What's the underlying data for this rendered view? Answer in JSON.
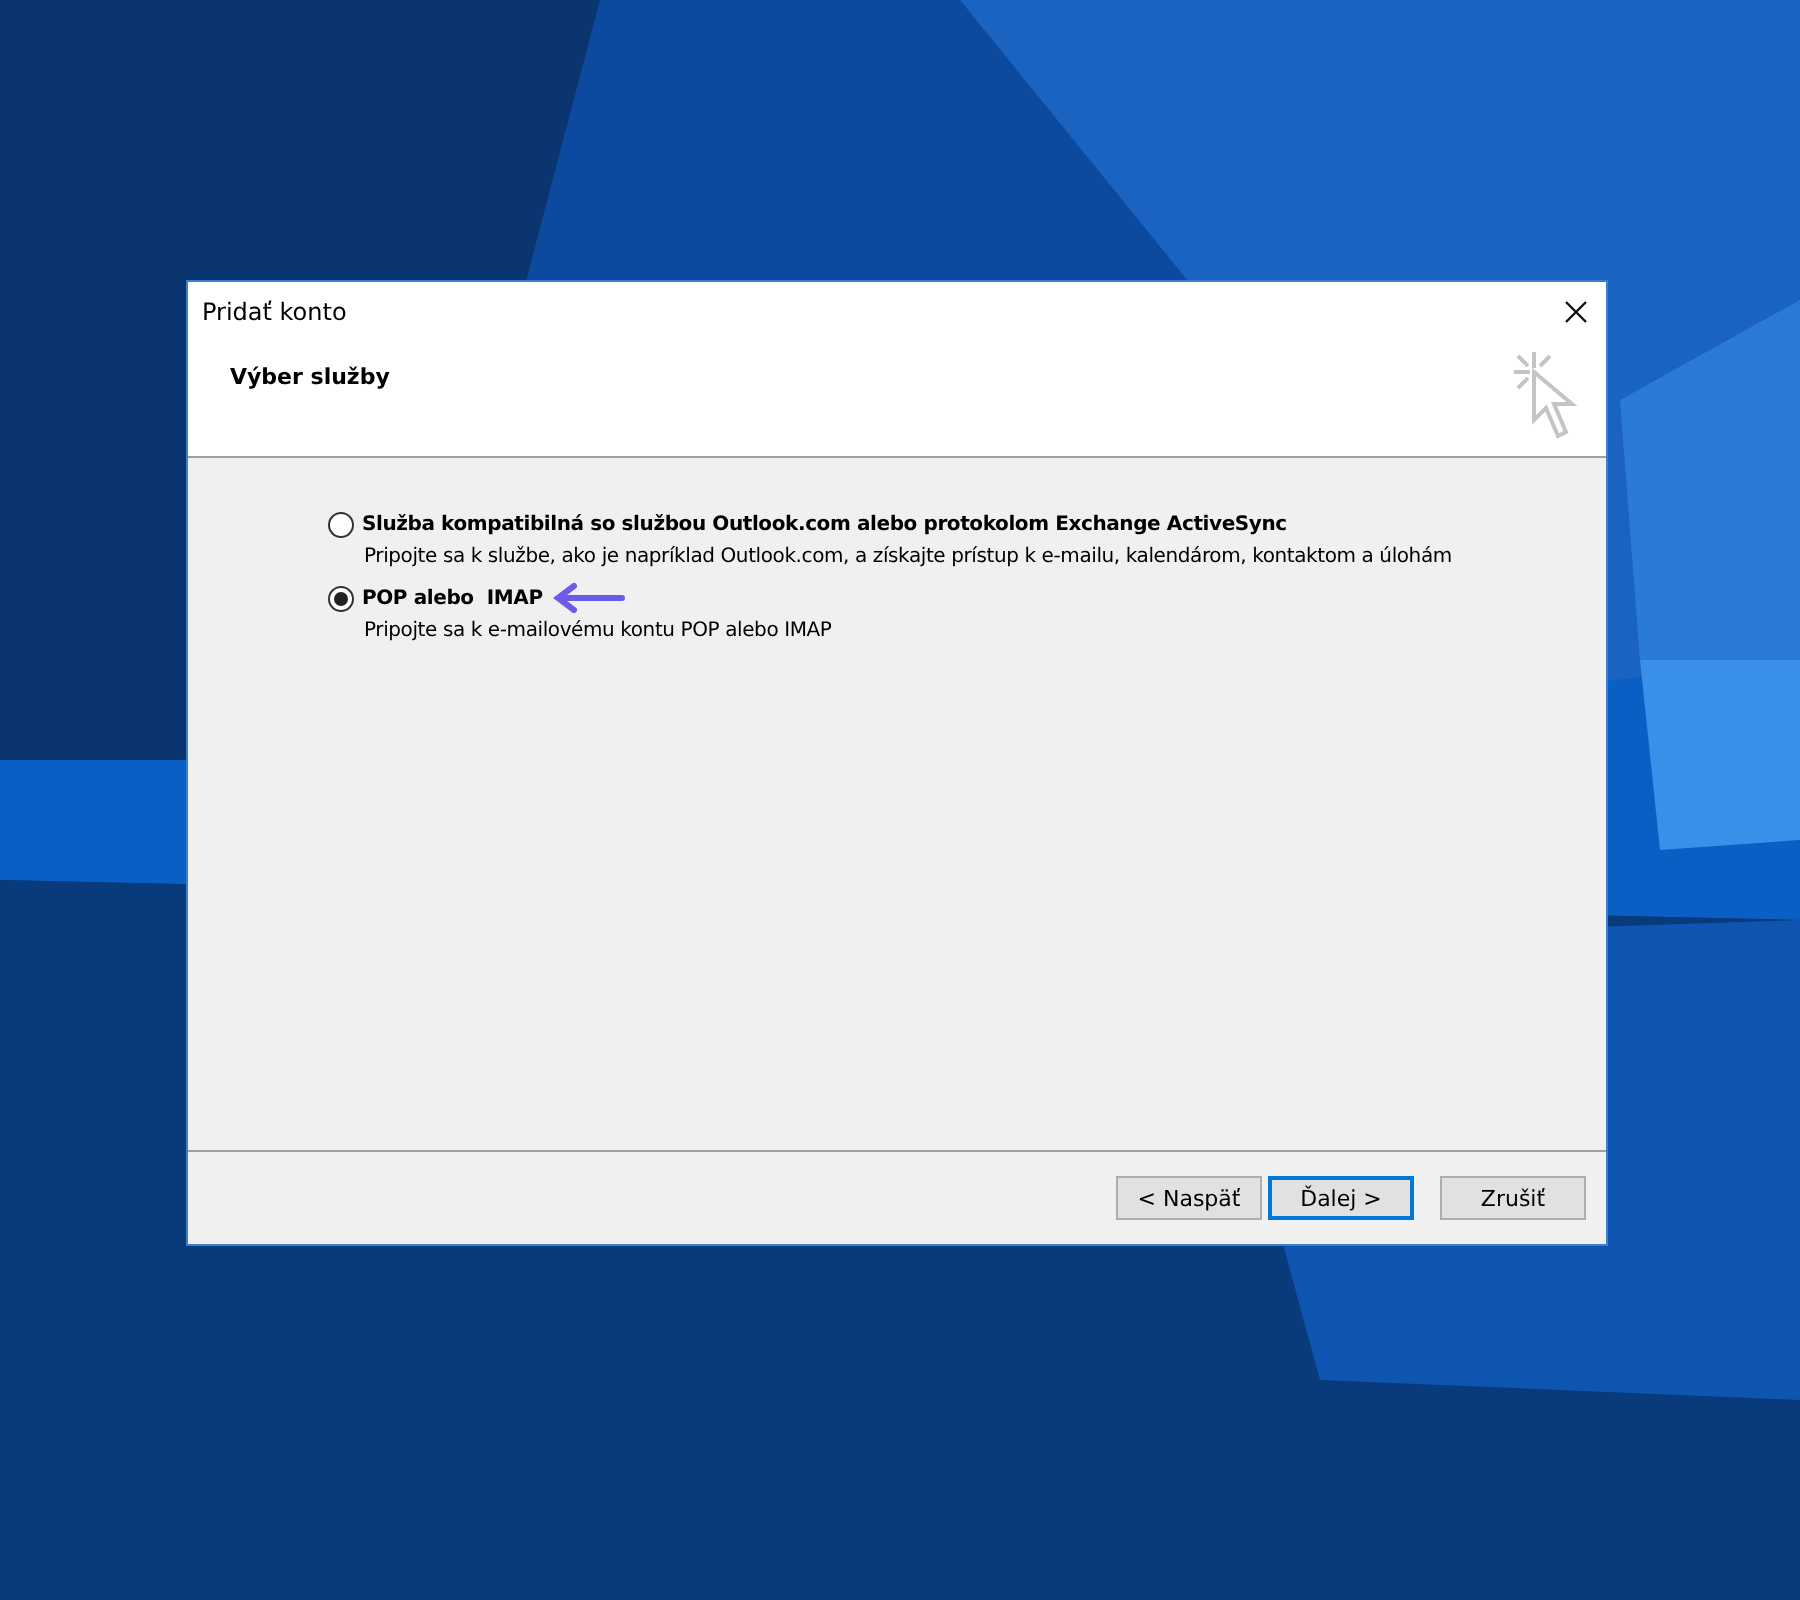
{
  "window": {
    "title": "Pridať konto",
    "heading": "Výber služby"
  },
  "options": [
    {
      "label": "Služba kompatibilná so službou Outlook.com alebo protokolom Exchange ActiveSync",
      "description": "Pripojte sa k službe, ako je napríklad Outlook.com, a získajte prístup k e-mailu, kalendárom, kontaktom a úlohám",
      "selected": false,
      "pointer": false
    },
    {
      "label": "POP alebo  IMAP",
      "description": "Pripojte sa k e-mailovému kontu POP alebo IMAP",
      "selected": true,
      "pointer": true
    }
  ],
  "buttons": [
    {
      "label": "< Naspäť",
      "default": false
    },
    {
      "label": "Ďalej >",
      "default": true
    },
    {
      "label": "Zrušiť",
      "default": false
    }
  ]
}
